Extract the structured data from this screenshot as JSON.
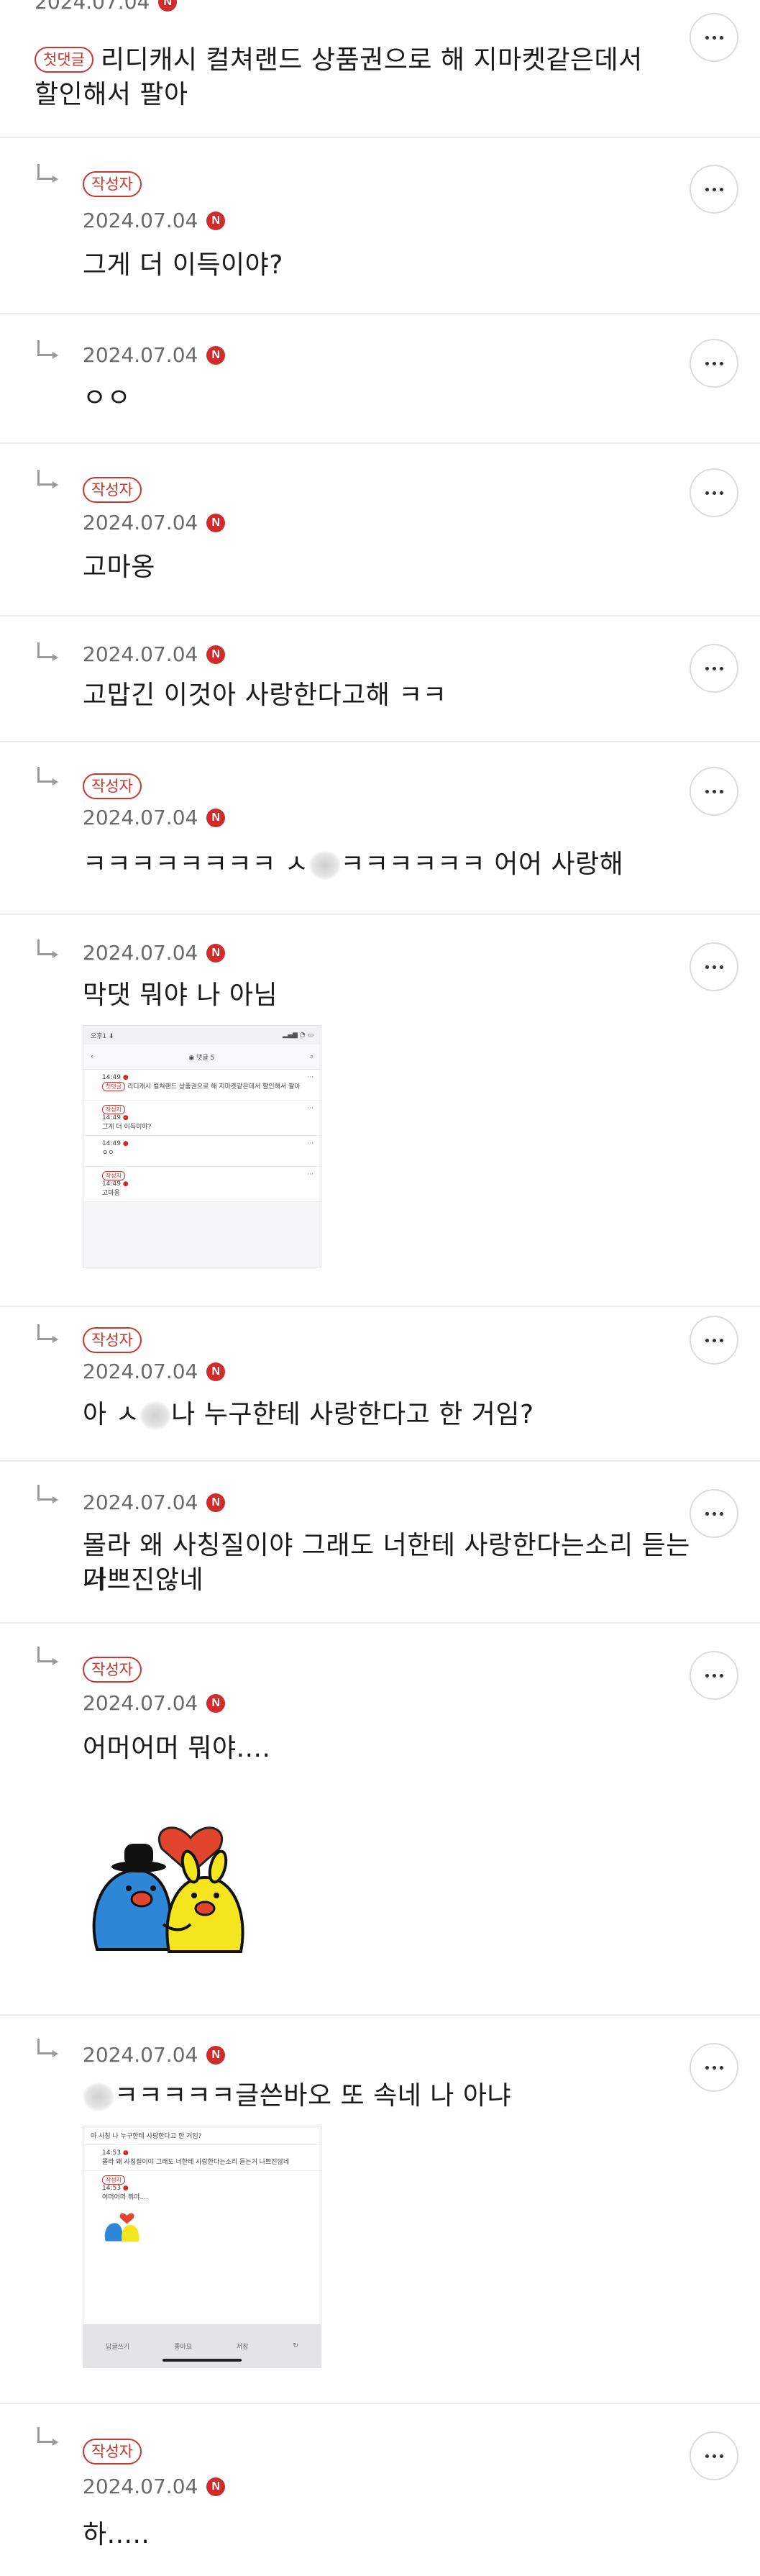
{
  "comments": [
    {
      "date": "2024.07.04",
      "badge": "첫댓글",
      "text_line1": "리디캐시 컬쳐랜드 상품권으로 해 지마켓같은데서",
      "text_line2": "할인해서 팔아"
    },
    {
      "badge": "작성자",
      "date": "2024.07.04",
      "text": "그게 더 이득이야?"
    },
    {
      "date": "2024.07.04",
      "text": "ㅇㅇ"
    },
    {
      "badge": "작성자",
      "date": "2024.07.04",
      "text": "고마옹"
    },
    {
      "date": "2024.07.04",
      "text": "고맙긴 이것아 사랑한다고해 ㅋㅋ"
    },
    {
      "badge": "작성자",
      "date": "2024.07.04",
      "text_a": "ㅋㅋㅋㅋㅋㅋㅋㅋ ㅅ",
      "text_b": "ㅋㅋㅋㅋㅋㅋ 어어 사랑해"
    },
    {
      "date": "2024.07.04",
      "text": "막댓 뭐야 나 아님"
    },
    {
      "badge": "작성자",
      "date": "2024.07.04",
      "text_a": "아 ㅅ",
      "text_b": "나 누구한테 사랑한다고 한 거임?"
    },
    {
      "date": "2024.07.04",
      "text_line1": "몰라 왜 사칭질이야 그래도 너한테 사랑한다는소리 듣는거",
      "text_line2": "나쁘진않네"
    },
    {
      "badge": "작성자",
      "date": "2024.07.04",
      "text": "어머어머 뭐야...."
    },
    {
      "date": "2024.07.04",
      "text_b": "ㅋㅋㅋㅋㅋ글쓴바오 또 속네 나 아냐"
    },
    {
      "badge": "작성자",
      "date": "2024.07.04",
      "text": "하....."
    }
  ],
  "shot1": {
    "status_time": "오후1 ⬇",
    "title": "◉ 댓글 5",
    "rows": [
      {
        "time": "14:49",
        "badge": "첫댓글",
        "text": "리디캐시 컬쳐랜드 상품권으로 해 지마켓같은데서 할인해서 팔아"
      },
      {
        "badge": "작성자",
        "time": "14:49",
        "text": "그게 더 이득이야?"
      },
      {
        "time": "14:49",
        "text": "ㅇㅇ"
      },
      {
        "badge": "작성자",
        "time": "14:49",
        "text": "고마옹"
      }
    ]
  },
  "shot2": {
    "rows": [
      {
        "text": "아 사칭 나 누구한테 사랑한다고 한 거임?"
      },
      {
        "time": "14:53",
        "text": "몰라 왜 사칭질이야 그래도 너한테 사랑한다는소리 듣는거 나쁘진않네"
      },
      {
        "badge": "작성자",
        "time": "14:53",
        "text": "어머어머 뭐야...."
      }
    ],
    "footer": [
      "답글쓰기",
      "좋아요",
      "저장",
      "↻"
    ]
  },
  "icons": {
    "n_badge": "N",
    "accent": "#c8382e"
  }
}
